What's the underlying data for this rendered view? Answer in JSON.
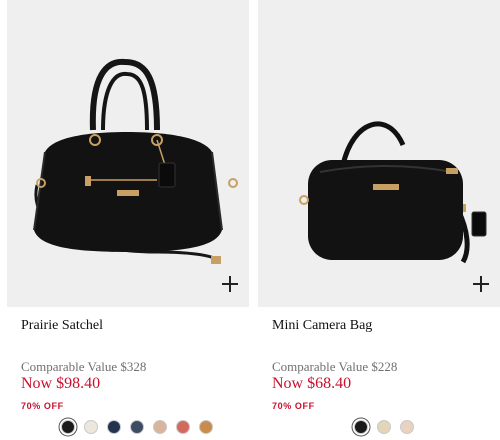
{
  "products": [
    {
      "name": "Prairie Satchel",
      "comparable": "Comparable Value $328",
      "price": "Now $98.40",
      "discount": "70% OFF",
      "bag_icon": "satchel-bag-image",
      "swatches": [
        "#1a1a1a",
        "#ece7dc",
        "#233451",
        "#3d4b63",
        "#d8b59c",
        "#d46a5e",
        "#c98b4e",
        "#2c4f4a"
      ]
    },
    {
      "name": "Mini Camera Bag",
      "comparable": "Comparable Value $228",
      "price": "Now $68.40",
      "discount": "70% OFF",
      "bag_icon": "camera-bag-image",
      "swatches": [
        "#1a1a1a",
        "#e3d6b8",
        "#ead2c0"
      ]
    }
  ],
  "colors": {
    "sale_red": "#c8102e",
    "image_bg": "#efefef",
    "bag_black": "#121212",
    "hardware_gold": "#c9a063"
  }
}
